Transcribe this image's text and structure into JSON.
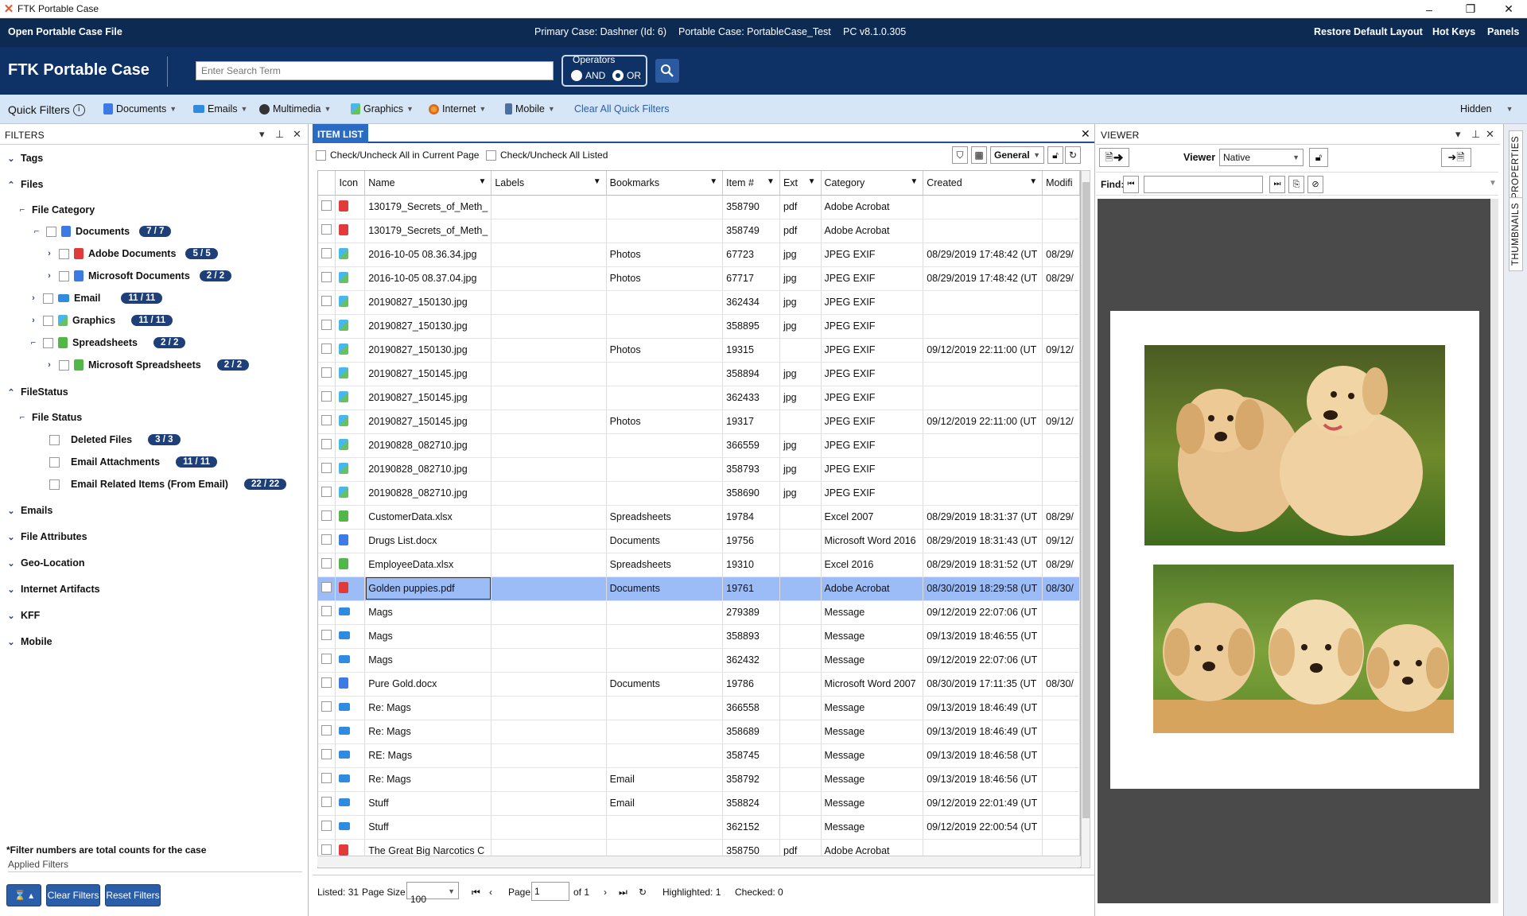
{
  "window": {
    "title": "FTK Portable Case",
    "controls": {
      "minimize": "–",
      "maximize": "❐",
      "close": "✕"
    }
  },
  "menubar": {
    "open": "Open Portable Case File",
    "primary_case": "Primary Case: Dashner (Id: 6)",
    "portable_case": "Portable Case: PortableCase_Test",
    "version": "PC v8.1.0.305",
    "restore": "Restore Default Layout",
    "hotkeys": "Hot Keys",
    "panels": "Panels"
  },
  "header": {
    "brand": "FTK Portable Case",
    "search_placeholder": "Enter Search Term",
    "operators_label": "Operators",
    "and_label": "AND",
    "or_label": "OR",
    "selected_operator": "OR"
  },
  "quickfilters": {
    "label": "Quick Filters",
    "items": [
      "Documents",
      "Emails",
      "Multimedia",
      "Graphics",
      "Internet",
      "Mobile"
    ],
    "clear": "Clear All Quick Filters",
    "hidden": "Hidden"
  },
  "filters": {
    "title": "FILTERS",
    "tags": "Tags",
    "files": "Files",
    "file_category": "File Category",
    "documents": "Documents",
    "documents_count": "7 / 7",
    "adobe": "Adobe Documents",
    "adobe_count": "5 / 5",
    "msdocs": "Microsoft Documents",
    "msdocs_count": "2 / 2",
    "email": "Email",
    "email_count": "11 / 11",
    "graphics": "Graphics",
    "graphics_count": "11 / 11",
    "spreadsheets": "Spreadsheets",
    "spreadsheets_count": "2 / 2",
    "msspread": "Microsoft Spreadsheets",
    "msspread_count": "2 / 2",
    "filestatus": "FileStatus",
    "file_status": "File Status",
    "deleted": "Deleted Files",
    "deleted_count": "3 / 3",
    "attach": "Email Attachments",
    "attach_count": "11 / 11",
    "related": "Email Related Items (From Email)",
    "related_count": "22 / 22",
    "emails": "Emails",
    "file_attributes": "File Attributes",
    "geo": "Geo-Location",
    "internet": "Internet Artifacts",
    "kff": "KFF",
    "mobile": "Mobile",
    "note": "*Filter numbers are total counts for the case",
    "applied": "Applied Filters",
    "clear_btn": "Clear Filters",
    "reset_btn": "Reset Filters"
  },
  "itemlist": {
    "tab": "ITEM LIST",
    "check_page": "Check/Uncheck All in Current Page",
    "check_listed": "Check/Uncheck All Listed",
    "view_select": "General",
    "columns": [
      "Icon",
      "Name",
      "Labels",
      "Bookmarks",
      "Item #",
      "Ext",
      "Category",
      "Created",
      "Modifi"
    ],
    "rows": [
      {
        "icon": "pdf",
        "name": "130179_Secrets_of_Meth_",
        "bookmarks": "",
        "item": "358790",
        "ext": "pdf",
        "category": "Adobe Acrobat",
        "created": "",
        "mod": ""
      },
      {
        "icon": "pdf",
        "name": "130179_Secrets_of_Meth_",
        "bookmarks": "",
        "item": "358749",
        "ext": "pdf",
        "category": "Adobe Acrobat",
        "created": "",
        "mod": ""
      },
      {
        "icon": "img",
        "name": "2016-10-05 08.36.34.jpg",
        "bookmarks": "Photos",
        "item": "67723",
        "ext": "jpg",
        "category": "JPEG EXIF",
        "created": "08/29/2019 17:48:42 (UT",
        "mod": "08/29/"
      },
      {
        "icon": "img",
        "name": "2016-10-05 08.37.04.jpg",
        "bookmarks": "Photos",
        "item": "67717",
        "ext": "jpg",
        "category": "JPEG EXIF",
        "created": "08/29/2019 17:48:42 (UT",
        "mod": "08/29/"
      },
      {
        "icon": "img",
        "name": "20190827_150130.jpg",
        "bookmarks": "",
        "item": "362434",
        "ext": "jpg",
        "category": "JPEG EXIF",
        "created": "",
        "mod": ""
      },
      {
        "icon": "img",
        "name": "20190827_150130.jpg",
        "bookmarks": "",
        "item": "358895",
        "ext": "jpg",
        "category": "JPEG EXIF",
        "created": "",
        "mod": ""
      },
      {
        "icon": "img",
        "name": "20190827_150130.jpg",
        "bookmarks": "Photos",
        "item": "19315",
        "ext": "",
        "category": "JPEG EXIF",
        "created": "09/12/2019 22:11:00 (UT",
        "mod": "09/12/"
      },
      {
        "icon": "img",
        "name": "20190827_150145.jpg",
        "bookmarks": "",
        "item": "358894",
        "ext": "jpg",
        "category": "JPEG EXIF",
        "created": "",
        "mod": ""
      },
      {
        "icon": "img",
        "name": "20190827_150145.jpg",
        "bookmarks": "",
        "item": "362433",
        "ext": "jpg",
        "category": "JPEG EXIF",
        "created": "",
        "mod": ""
      },
      {
        "icon": "img",
        "name": "20190827_150145.jpg",
        "bookmarks": "Photos",
        "item": "19317",
        "ext": "",
        "category": "JPEG EXIF",
        "created": "09/12/2019 22:11:00 (UT",
        "mod": "09/12/"
      },
      {
        "icon": "img",
        "name": "20190828_082710.jpg",
        "bookmarks": "",
        "item": "366559",
        "ext": "jpg",
        "category": "JPEG EXIF",
        "created": "",
        "mod": ""
      },
      {
        "icon": "img",
        "name": "20190828_082710.jpg",
        "bookmarks": "",
        "item": "358793",
        "ext": "jpg",
        "category": "JPEG EXIF",
        "created": "",
        "mod": ""
      },
      {
        "icon": "img",
        "name": "20190828_082710.jpg",
        "bookmarks": "",
        "item": "358690",
        "ext": "jpg",
        "category": "JPEG EXIF",
        "created": "",
        "mod": ""
      },
      {
        "icon": "xls",
        "name": "CustomerData.xlsx",
        "bookmarks": "Spreadsheets",
        "item": "19784",
        "ext": "",
        "category": "Excel 2007",
        "created": "08/29/2019 18:31:37 (UT",
        "mod": "08/29/"
      },
      {
        "icon": "doc",
        "name": "Drugs List.docx",
        "bookmarks": "Documents",
        "item": "19756",
        "ext": "",
        "category": "Microsoft Word 2016",
        "created": "08/29/2019 18:31:43 (UT",
        "mod": "09/12/"
      },
      {
        "icon": "xls",
        "name": "EmployeeData.xlsx",
        "bookmarks": "Spreadsheets",
        "item": "19310",
        "ext": "",
        "category": "Excel 2016",
        "created": "08/29/2019 18:31:52 (UT",
        "mod": "08/29/"
      },
      {
        "icon": "pdf",
        "name": "Golden puppies.pdf",
        "bookmarks": "Documents",
        "item": "19761",
        "ext": "",
        "category": "Adobe Acrobat",
        "created": "08/30/2019 18:29:58 (UT",
        "mod": "08/30/",
        "selected": true
      },
      {
        "icon": "mail",
        "name": "Mags",
        "bookmarks": "",
        "item": "279389",
        "ext": "",
        "category": "Message",
        "created": "09/12/2019 22:07:06 (UT",
        "mod": ""
      },
      {
        "icon": "mail",
        "name": "Mags",
        "bookmarks": "",
        "item": "358893",
        "ext": "",
        "category": "Message",
        "created": "09/13/2019 18:46:55 (UT",
        "mod": ""
      },
      {
        "icon": "mail",
        "name": "Mags",
        "bookmarks": "",
        "item": "362432",
        "ext": "",
        "category": "Message",
        "created": "09/12/2019 22:07:06 (UT",
        "mod": ""
      },
      {
        "icon": "doc",
        "name": "Pure Gold.docx",
        "bookmarks": "Documents",
        "item": "19786",
        "ext": "",
        "category": "Microsoft Word 2007",
        "created": "08/30/2019 17:11:35 (UT",
        "mod": "08/30/"
      },
      {
        "icon": "mail",
        "name": "Re: Mags",
        "bookmarks": "",
        "item": "366558",
        "ext": "",
        "category": "Message",
        "created": "09/13/2019 18:46:49 (UT",
        "mod": ""
      },
      {
        "icon": "mail",
        "name": "Re: Mags",
        "bookmarks": "",
        "item": "358689",
        "ext": "",
        "category": "Message",
        "created": "09/13/2019 18:46:49 (UT",
        "mod": ""
      },
      {
        "icon": "mail",
        "name": "RE: Mags",
        "bookmarks": "",
        "item": "358745",
        "ext": "",
        "category": "Message",
        "created": "09/13/2019 18:46:58 (UT",
        "mod": ""
      },
      {
        "icon": "mail",
        "name": "Re: Mags",
        "bookmarks": "Email",
        "item": "358792",
        "ext": "",
        "category": "Message",
        "created": "09/13/2019 18:46:56 (UT",
        "mod": ""
      },
      {
        "icon": "mail",
        "name": "Stuff",
        "bookmarks": "Email",
        "item": "358824",
        "ext": "",
        "category": "Message",
        "created": "09/12/2019 22:01:49 (UT",
        "mod": ""
      },
      {
        "icon": "mail",
        "name": "Stuff",
        "bookmarks": "",
        "item": "362152",
        "ext": "",
        "category": "Message",
        "created": "09/12/2019 22:00:54 (UT",
        "mod": ""
      },
      {
        "icon": "pdf",
        "name": "The Great Big Narcotics C",
        "bookmarks": "",
        "item": "358750",
        "ext": "pdf",
        "category": "Adobe Acrobat",
        "created": "",
        "mod": ""
      }
    ],
    "footer": {
      "listed": "Listed: 31",
      "page_size_label": "Page Size",
      "page_size": "100",
      "page_label": "Page",
      "page": "1",
      "of": "of 1",
      "highlighted": "Highlighted: 1",
      "checked": "Checked: 0"
    }
  },
  "viewer": {
    "title": "VIEWER",
    "viewer_label": "Viewer",
    "viewer_mode": "Native",
    "find_label": "Find:"
  },
  "sidetabs": {
    "properties": "PROPERTIES",
    "thumbnails": "THUMBNAILS"
  }
}
